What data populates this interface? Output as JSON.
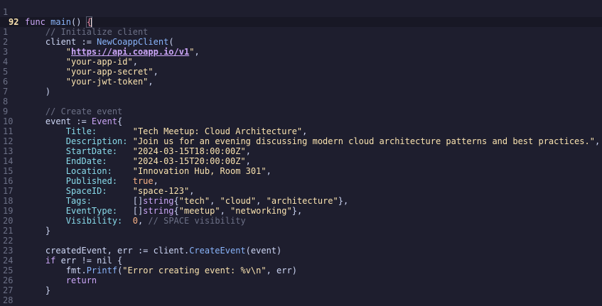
{
  "editor": {
    "lines": [
      {
        "num": "1",
        "current": false,
        "tokens": []
      },
      {
        "num": "92",
        "current": true,
        "tokens": [
          {
            "t": "kw",
            "v": "func "
          },
          {
            "t": "fn",
            "v": "main"
          },
          {
            "t": "plain",
            "v": "() "
          },
          {
            "t": "brace",
            "v": "{"
          },
          {
            "t": "cursor",
            "v": ""
          }
        ]
      },
      {
        "num": "1",
        "current": false,
        "tokens": [
          {
            "t": "plain",
            "v": "    "
          },
          {
            "t": "cm",
            "v": "// Initialize client"
          }
        ]
      },
      {
        "num": "2",
        "current": false,
        "tokens": [
          {
            "t": "plain",
            "v": "    client := "
          },
          {
            "t": "fn",
            "v": "NewCoappClient"
          },
          {
            "t": "plain",
            "v": "("
          }
        ]
      },
      {
        "num": "3",
        "current": false,
        "tokens": [
          {
            "t": "plain",
            "v": "        "
          },
          {
            "t": "str",
            "v": "\""
          },
          {
            "t": "url",
            "v": "https://api.coapp.io/v1"
          },
          {
            "t": "str",
            "v": "\""
          },
          {
            "t": "plain",
            "v": ","
          }
        ]
      },
      {
        "num": "4",
        "current": false,
        "tokens": [
          {
            "t": "plain",
            "v": "        "
          },
          {
            "t": "str",
            "v": "\"your-app-id\""
          },
          {
            "t": "plain",
            "v": ","
          }
        ]
      },
      {
        "num": "5",
        "current": false,
        "tokens": [
          {
            "t": "plain",
            "v": "        "
          },
          {
            "t": "str",
            "v": "\"your-app-secret\""
          },
          {
            "t": "plain",
            "v": ","
          }
        ]
      },
      {
        "num": "6",
        "current": false,
        "tokens": [
          {
            "t": "plain",
            "v": "        "
          },
          {
            "t": "str",
            "v": "\"your-jwt-token\""
          },
          {
            "t": "plain",
            "v": ","
          }
        ]
      },
      {
        "num": "7",
        "current": false,
        "tokens": [
          {
            "t": "plain",
            "v": "    )"
          }
        ]
      },
      {
        "num": "8",
        "current": false,
        "tokens": []
      },
      {
        "num": "9",
        "current": false,
        "tokens": [
          {
            "t": "plain",
            "v": "    "
          },
          {
            "t": "cm",
            "v": "// Create event"
          }
        ]
      },
      {
        "num": "10",
        "current": false,
        "tokens": [
          {
            "t": "plain",
            "v": "    event := "
          },
          {
            "t": "ty",
            "v": "Event"
          },
          {
            "t": "plain",
            "v": "{"
          }
        ]
      },
      {
        "num": "11",
        "current": false,
        "tokens": [
          {
            "t": "plain",
            "v": "        "
          },
          {
            "t": "field",
            "v": "Title:"
          },
          {
            "t": "plain",
            "v": "       "
          },
          {
            "t": "str",
            "v": "\"Tech Meetup: Cloud Architecture\""
          },
          {
            "t": "plain",
            "v": ","
          }
        ]
      },
      {
        "num": "12",
        "current": false,
        "tokens": [
          {
            "t": "plain",
            "v": "        "
          },
          {
            "t": "field",
            "v": "Description:"
          },
          {
            "t": "plain",
            "v": " "
          },
          {
            "t": "str",
            "v": "\"Join us for an evening discussing modern cloud architecture patterns and best practices.\""
          },
          {
            "t": "plain",
            "v": ","
          }
        ]
      },
      {
        "num": "13",
        "current": false,
        "tokens": [
          {
            "t": "plain",
            "v": "        "
          },
          {
            "t": "field",
            "v": "StartDate:"
          },
          {
            "t": "plain",
            "v": "   "
          },
          {
            "t": "str",
            "v": "\"2024-03-15T18:00:00Z\""
          },
          {
            "t": "plain",
            "v": ","
          }
        ]
      },
      {
        "num": "14",
        "current": false,
        "tokens": [
          {
            "t": "plain",
            "v": "        "
          },
          {
            "t": "field",
            "v": "EndDate:"
          },
          {
            "t": "plain",
            "v": "     "
          },
          {
            "t": "str",
            "v": "\"2024-03-15T20:00:00Z\""
          },
          {
            "t": "plain",
            "v": ","
          }
        ]
      },
      {
        "num": "15",
        "current": false,
        "tokens": [
          {
            "t": "plain",
            "v": "        "
          },
          {
            "t": "field",
            "v": "Location:"
          },
          {
            "t": "plain",
            "v": "    "
          },
          {
            "t": "str",
            "v": "\"Innovation Hub, Room 301\""
          },
          {
            "t": "plain",
            "v": ","
          }
        ]
      },
      {
        "num": "16",
        "current": false,
        "tokens": [
          {
            "t": "plain",
            "v": "        "
          },
          {
            "t": "field",
            "v": "Published:"
          },
          {
            "t": "plain",
            "v": "   "
          },
          {
            "t": "bool",
            "v": "true"
          },
          {
            "t": "plain",
            "v": ","
          }
        ]
      },
      {
        "num": "17",
        "current": false,
        "tokens": [
          {
            "t": "plain",
            "v": "        "
          },
          {
            "t": "field",
            "v": "SpaceID:"
          },
          {
            "t": "plain",
            "v": "     "
          },
          {
            "t": "str",
            "v": "\"space-123\""
          },
          {
            "t": "plain",
            "v": ","
          }
        ]
      },
      {
        "num": "18",
        "current": false,
        "tokens": [
          {
            "t": "plain",
            "v": "        "
          },
          {
            "t": "field",
            "v": "Tags:"
          },
          {
            "t": "plain",
            "v": "        []"
          },
          {
            "t": "ty",
            "v": "string"
          },
          {
            "t": "plain",
            "v": "{"
          },
          {
            "t": "str",
            "v": "\"tech\""
          },
          {
            "t": "plain",
            "v": ", "
          },
          {
            "t": "str",
            "v": "\"cloud\""
          },
          {
            "t": "plain",
            "v": ", "
          },
          {
            "t": "str",
            "v": "\"architecture\""
          },
          {
            "t": "plain",
            "v": "},"
          }
        ]
      },
      {
        "num": "19",
        "current": false,
        "tokens": [
          {
            "t": "plain",
            "v": "        "
          },
          {
            "t": "field",
            "v": "EventType:"
          },
          {
            "t": "plain",
            "v": "   []"
          },
          {
            "t": "ty",
            "v": "string"
          },
          {
            "t": "plain",
            "v": "{"
          },
          {
            "t": "str",
            "v": "\"meetup\""
          },
          {
            "t": "plain",
            "v": ", "
          },
          {
            "t": "str",
            "v": "\"networking\""
          },
          {
            "t": "plain",
            "v": "},"
          }
        ]
      },
      {
        "num": "20",
        "current": false,
        "tokens": [
          {
            "t": "plain",
            "v": "        "
          },
          {
            "t": "field",
            "v": "Visibility:"
          },
          {
            "t": "plain",
            "v": "  "
          },
          {
            "t": "num",
            "v": "0"
          },
          {
            "t": "plain",
            "v": ", "
          },
          {
            "t": "cm",
            "v": "// SPACE visibility"
          }
        ]
      },
      {
        "num": "21",
        "current": false,
        "tokens": [
          {
            "t": "plain",
            "v": "    }"
          }
        ]
      },
      {
        "num": "22",
        "current": false,
        "tokens": []
      },
      {
        "num": "23",
        "current": false,
        "tokens": [
          {
            "t": "plain",
            "v": "    createdEvent, err := client."
          },
          {
            "t": "fn",
            "v": "CreateEvent"
          },
          {
            "t": "plain",
            "v": "(event)"
          }
        ]
      },
      {
        "num": "24",
        "current": false,
        "tokens": [
          {
            "t": "plain",
            "v": "    "
          },
          {
            "t": "kw",
            "v": "if"
          },
          {
            "t": "plain",
            "v": " err != nil {"
          }
        ]
      },
      {
        "num": "25",
        "current": false,
        "tokens": [
          {
            "t": "plain",
            "v": "        fmt."
          },
          {
            "t": "fn",
            "v": "Printf"
          },
          {
            "t": "plain",
            "v": "("
          },
          {
            "t": "str",
            "v": "\"Error creating event: %v\\n\""
          },
          {
            "t": "plain",
            "v": ", err)"
          }
        ]
      },
      {
        "num": "26",
        "current": false,
        "tokens": [
          {
            "t": "plain",
            "v": "        "
          },
          {
            "t": "kw",
            "v": "return"
          }
        ]
      },
      {
        "num": "27",
        "current": false,
        "tokens": [
          {
            "t": "plain",
            "v": "    }"
          }
        ]
      },
      {
        "num": "28",
        "current": false,
        "tokens": []
      }
    ]
  },
  "colors": {
    "background": "#1e1e2e",
    "current_line": "#181825",
    "keyword": "#cba6f7",
    "function": "#89b4fa",
    "string": "#f9e2af",
    "comment": "#6c7086",
    "line_number": "#6c7086",
    "current_line_number": "#f9e2af"
  }
}
